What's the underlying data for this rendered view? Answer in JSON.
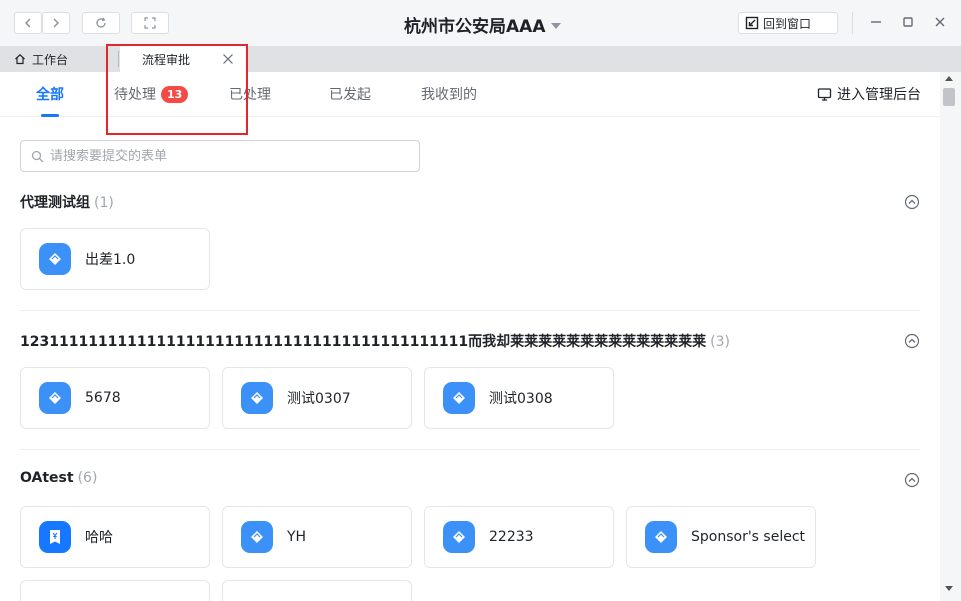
{
  "window": {
    "title": "杭州市公安局AAA",
    "back_to_window": "回到窗口"
  },
  "tabs": {
    "home": "工作台",
    "active": "流程审批"
  },
  "subtabs": {
    "all": "全部",
    "pending": "待处理",
    "pending_count": "13",
    "processed": "已处理",
    "initiated": "已发起",
    "received": "我收到的",
    "admin": "进入管理后台"
  },
  "search": {
    "placeholder": "请搜索要提交的表单"
  },
  "groups": [
    {
      "name": "代理测试组",
      "count": "(1)",
      "items": [
        "出差1.0"
      ]
    },
    {
      "name": "1231111111111111111111111111111111111111111111而我却莱莱莱莱莱莱莱莱莱莱莱莱莱莱",
      "count": "(3)",
      "items": [
        "5678",
        "测试0307",
        "测试0308"
      ]
    },
    {
      "name": "OAtest",
      "count": "(6)",
      "items": [
        "哈哈",
        "YH",
        "22233",
        "Sponsor's select"
      ]
    }
  ],
  "colors": {
    "accent": "#1677ff",
    "badge": "#f54a45",
    "icon_bg": "#3b91f7",
    "highlight": "#e3262a"
  }
}
